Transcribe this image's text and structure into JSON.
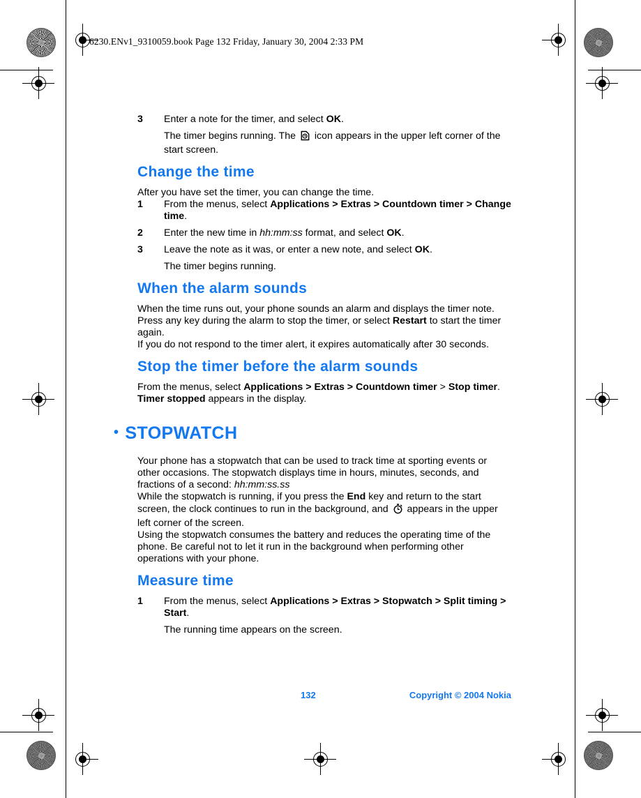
{
  "header": {
    "filestamp": "6230.ENv1_9310059.book  Page 132  Friday, January 30, 2004  2:33 PM"
  },
  "colors": {
    "heading_blue": "#1478F0",
    "body_black": "#000000",
    "page_background": "#FFFFFF"
  },
  "content": {
    "step3_timer_num": "3",
    "step3_timer_text_a": "Enter a note for the timer, and select ",
    "step3_timer_bold": "OK",
    "step3_timer_text_b": ".",
    "step3_timer_sub_a": "The timer begins running. The ",
    "step3_timer_sub_b": " icon appears in the upper left corner of the start screen.",
    "heading_change_time": "Change the time",
    "change_time_intro": "After you have set the timer, you can change the time.",
    "ct_1_num": "1",
    "ct_1_text_a": "From the menus, select ",
    "ct_1_bold": "Applications > Extras > Countdown timer > Change time",
    "ct_1_text_b": ".",
    "ct_2_num": "2",
    "ct_2_text_a": "Enter the new time in ",
    "ct_2_italic": "hh:mm:ss",
    "ct_2_text_b": " format, and select ",
    "ct_2_bold": "OK",
    "ct_2_text_c": ".",
    "ct_3_num": "3",
    "ct_3_text_a": "Leave the note as it was, or enter a new note, and select ",
    "ct_3_bold": "OK",
    "ct_3_text_b": ".",
    "ct_3_sub": "The timer begins running.",
    "heading_alarm_sounds": "When the alarm sounds",
    "alarm_p1": "When the time runs out, your phone sounds an alarm and displays the timer note.",
    "alarm_p2_a": "Press any key during the alarm to stop the timer, or select ",
    "alarm_p2_bold": "Restart",
    "alarm_p2_b": " to start the timer again.",
    "alarm_p3": "If you do not respond to the timer alert, it expires automatically after 30 seconds.",
    "heading_stop_timer": "Stop the timer before the alarm sounds",
    "stop_p1_a": "From the menus, select ",
    "stop_p1_bold1": "Applications > Extras > Countdown timer",
    "stop_p1_b": " > ",
    "stop_p1_bold2": "Stop timer",
    "stop_p1_c": ".",
    "stop_p2_bold": "Timer stopped",
    "stop_p2_text": " appears in the display.",
    "chapter_bullet": "•",
    "chapter_title": "STOPWATCH",
    "sw_p1_a": "Your phone has a stopwatch that can be used to track time at sporting events or other occasions. The stopwatch displays time in hours, minutes, seconds, and fractions of a second: ",
    "sw_p1_italic": "hh:mm:ss.ss",
    "sw_p2_a": "While the stopwatch is running, if you press the ",
    "sw_p2_bold": "End",
    "sw_p2_b": " key and return to the start screen, the clock continues to run in the background, and ",
    "sw_p2_c": " appears in the upper left corner of the screen.",
    "sw_p3": "Using the stopwatch consumes the battery and reduces the operating time of the phone. Be careful not to let it run in the background when performing other operations with your phone.",
    "heading_measure_time": "Measure time",
    "mt_1_num": "1",
    "mt_1_text_a": "From the menus, select ",
    "mt_1_bold": "Applications > Extras > Stopwatch > Split timing > Start",
    "mt_1_text_b": ".",
    "mt_1_sub": "The running time appears on the screen."
  },
  "icons": {
    "timer_note_icon": "timer-note-icon",
    "stopwatch_icon": "stopwatch-icon"
  },
  "footer": {
    "page_number": "132",
    "copyright": "Copyright © 2004 Nokia"
  }
}
